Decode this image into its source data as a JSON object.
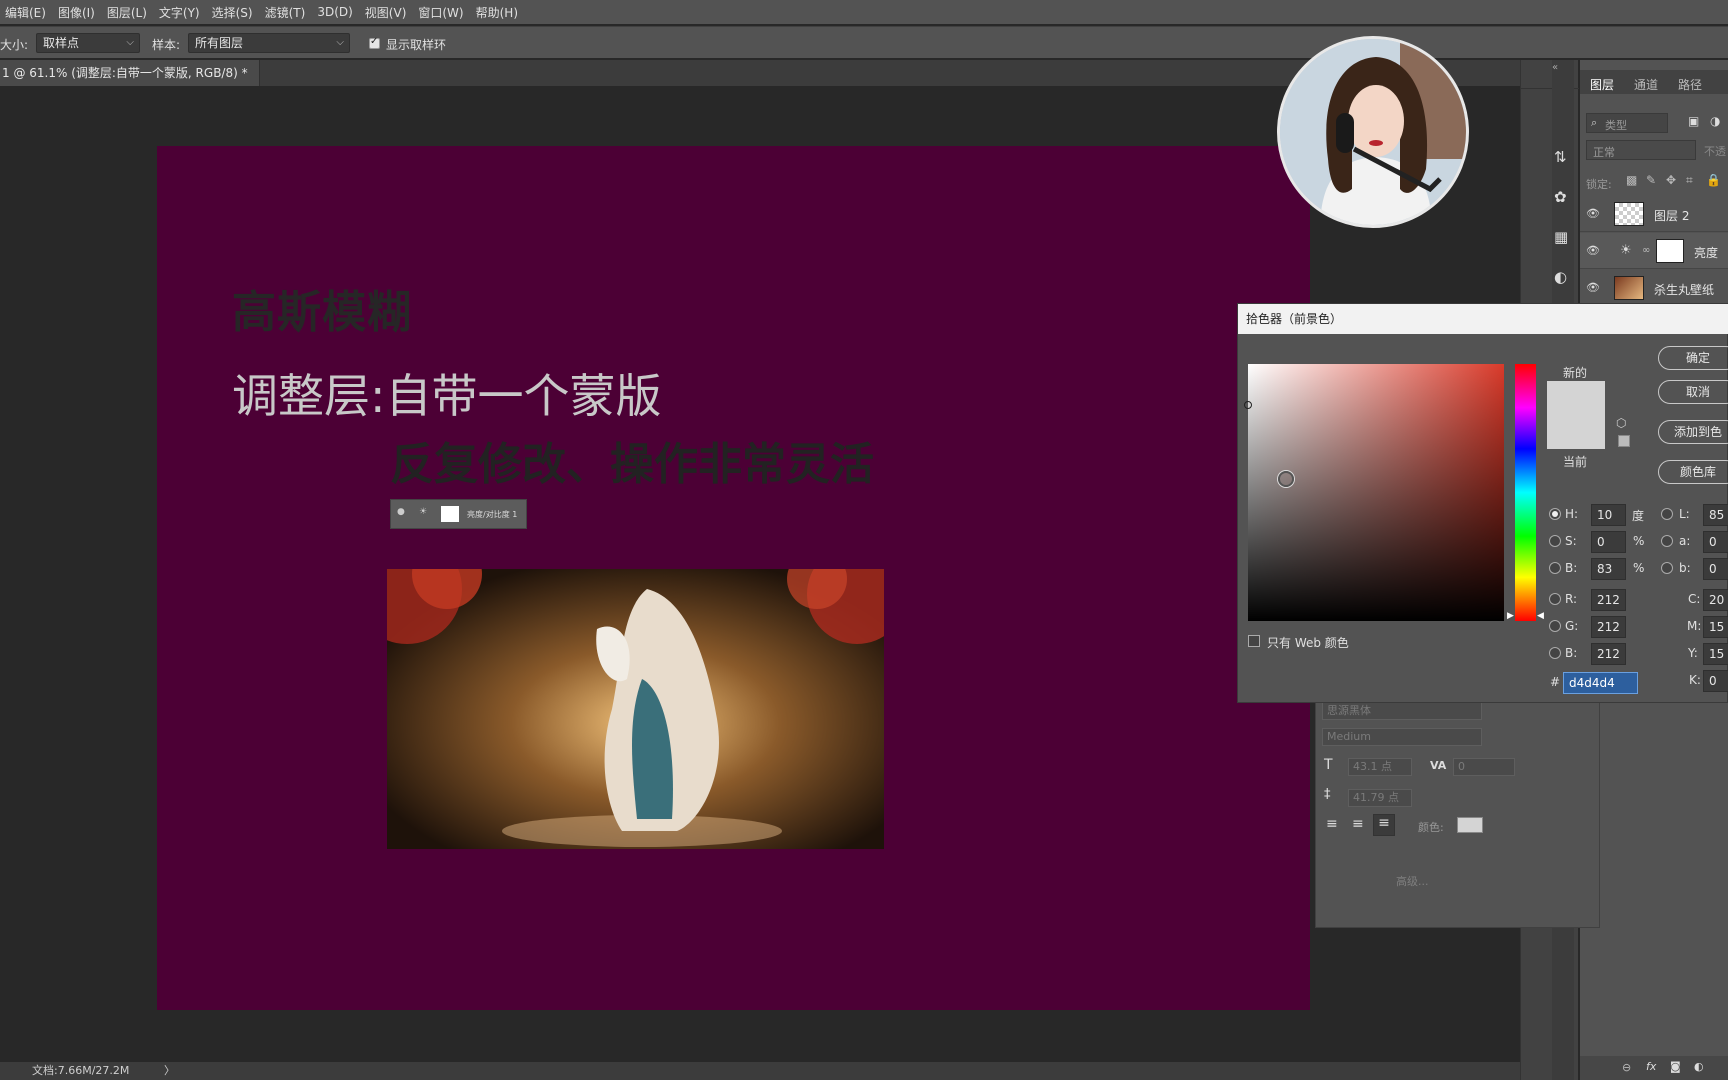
{
  "menu": [
    "编辑(E)",
    "图像(I)",
    "图层(L)",
    "文字(Y)",
    "选择(S)",
    "滤镜(T)",
    "3D(D)",
    "视图(V)",
    "窗口(W)",
    "帮助(H)"
  ],
  "options": {
    "size_label": "大小:",
    "size_value": "取样点",
    "sample_label": "样本:",
    "sample_value": "所有图层",
    "show_ring_label": "显示取样环"
  },
  "tab": {
    "title": "1 @ 61.1% (调整层:自带一个蒙版, RGB/8) *",
    "close": "×"
  },
  "canvas": {
    "line1": "高斯模糊",
    "line2": "调整层:自带一个蒙版",
    "line3": "反复修改、操作非常灵活",
    "mini_layer_text": "亮度/对比度 1"
  },
  "layers_panel": {
    "tabs": [
      "图层",
      "通道",
      "路径"
    ],
    "search_placeholder": "类型",
    "blend_mode": "正常",
    "opacity_label": "不透",
    "lock_label": "锁定:",
    "layers": [
      {
        "name": "图层 2"
      },
      {
        "name": "亮度"
      },
      {
        "name": "杀生丸壁纸"
      }
    ]
  },
  "color_picker": {
    "title": "拾色器（前景色）",
    "new_label": "新的",
    "current_label": "当前",
    "new_color": "#d4d4d4",
    "current_color": "#d4d4d4",
    "ok": "确定",
    "cancel": "取消",
    "add_swatch": "添加到色",
    "color_lib": "颜色库",
    "web_only_label": "只有 Web 颜色",
    "hsb": {
      "H": "10",
      "H_unit": "度",
      "S": "0",
      "S_unit": "%",
      "B": "83",
      "B_unit": "%"
    },
    "rgb": {
      "R": "212",
      "G": "212",
      "B": "212"
    },
    "lab": {
      "L": "85",
      "a": "0",
      "b": "0"
    },
    "cmyk": {
      "C": "20",
      "M": "15",
      "Y": "15",
      "K": "0"
    },
    "hex_label": "#",
    "hex": "d4d4d4"
  },
  "char_panel": {
    "font": "思源黑体",
    "style": "Medium",
    "size": "43.1 点",
    "va": "0",
    "leading": "41.79 点",
    "color_label": "颜色:",
    "advanced": "高级..."
  },
  "status": {
    "doc": "文档:7.66M/27.2M",
    "arrow": "〉"
  }
}
